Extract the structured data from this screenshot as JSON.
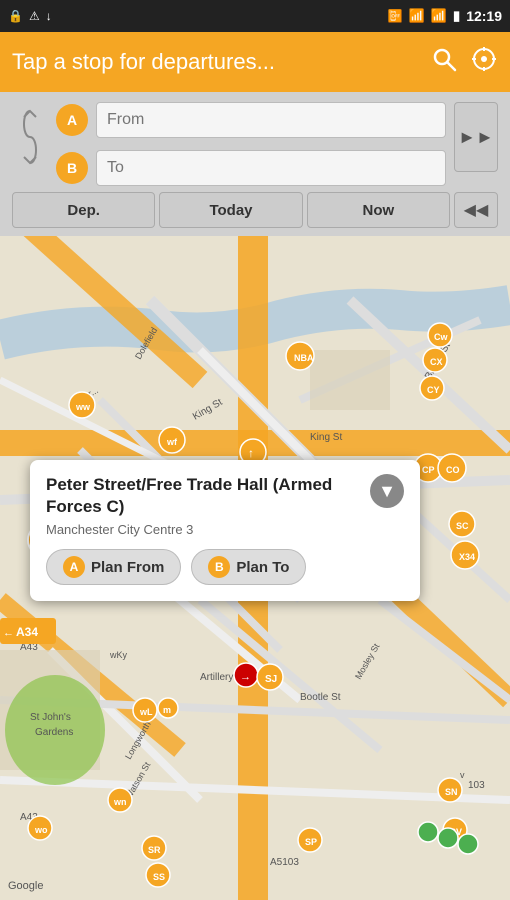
{
  "status_bar": {
    "time": "12:19",
    "icons_left": [
      "usb-icon",
      "alert-icon",
      "download-icon"
    ],
    "icons_right": [
      "no-sim-icon",
      "wifi-icon",
      "signal-icon",
      "battery-icon"
    ]
  },
  "top_bar": {
    "title": "Tap a stop for departures...",
    "search_icon_label": "search",
    "location_icon_label": "my-location"
  },
  "route_planner": {
    "from_label": "A",
    "from_placeholder": "From",
    "to_label": "B",
    "to_placeholder": "To",
    "swap_icon": "↺",
    "forward_icon": "▶▶",
    "dep_button": "Dep.",
    "today_button": "Today",
    "now_button": "Now",
    "back_icon": "◀◀"
  },
  "map": {
    "drag_handle": "≡"
  },
  "popup": {
    "title": "Peter Street/Free Trade Hall (Armed Forces C)",
    "subtitle": "Manchester City Centre 3",
    "close_icon": "▼",
    "plan_from_label": "A",
    "plan_from_text": "Plan From",
    "plan_to_label": "B",
    "plan_to_text": "Plan To"
  },
  "footer": {
    "google": "Google"
  }
}
